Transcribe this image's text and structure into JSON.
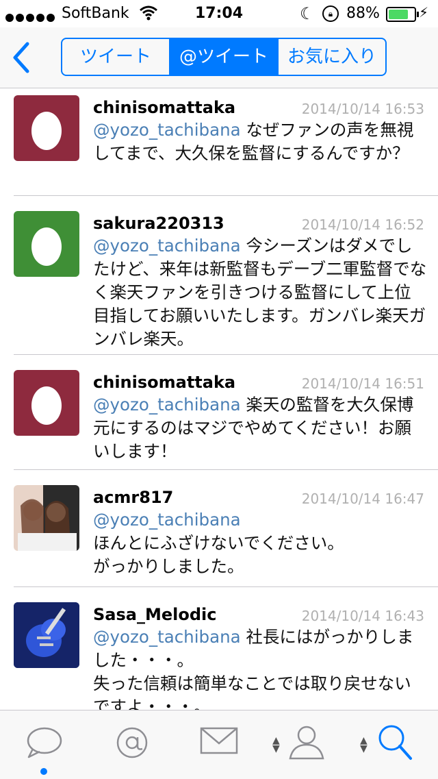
{
  "status_bar": {
    "carrier": "SoftBank",
    "time": "17:04",
    "battery_percent": "88%",
    "battery_level": 0.88
  },
  "nav": {
    "segments": [
      {
        "label": "ツイート",
        "selected": false
      },
      {
        "label": "@ツイート",
        "selected": true
      },
      {
        "label": "お気に入り",
        "selected": false
      }
    ]
  },
  "tweets": [
    {
      "username": "chinisomattaka",
      "datetime": "2014/10/14 16:53",
      "mention": "@yozo_tachibana",
      "body": " なぜファンの声を無視してまで、大久保を監督にするんですか？",
      "avatar_color": "#8e2a3e"
    },
    {
      "username": "sakura220313",
      "datetime": "2014/10/14 16:52",
      "mention": "@yozo_tachibana",
      "body": " 今シーズンはダメでしたけど、来年は新監督もデーブ二軍監督でなく楽天ファンを引きつける監督にして上位目指してお願いいたします。ガンバレ楽天ガンバレ楽天。",
      "avatar_color": "#3f8f36"
    },
    {
      "username": "chinisomattaka",
      "datetime": "2014/10/14 16:51",
      "mention": "@yozo_tachibana",
      "body": " 楽天の監督を大久保博元にするのはマジでやめてください！お願いします！",
      "avatar_color": "#8e2a3e"
    },
    {
      "username": "acmr817",
      "datetime": "2014/10/14 16:47",
      "mention": "@yozo_tachibana",
      "body_lines": [
        "ほんとにふざけないでください。",
        "がっかりしました。"
      ],
      "avatar_color": "#2a2a2a"
    },
    {
      "username": "Sasa_Melodic",
      "datetime": "2014/10/14 16:43",
      "mention": "@yozo_tachibana",
      "body": " 社長にはがっかりしました・・・。",
      "body2": "失った信頼は簡単なことでは取り戻せないですよ・・・。",
      "avatar_color": "#1c2f8a"
    }
  ],
  "tab_bar": {
    "icons": [
      "speech-bubble-icon",
      "at-sign-icon",
      "envelope-icon",
      "person-icon",
      "search-icon"
    ],
    "selected_index": 4,
    "accent": "#007aff"
  }
}
